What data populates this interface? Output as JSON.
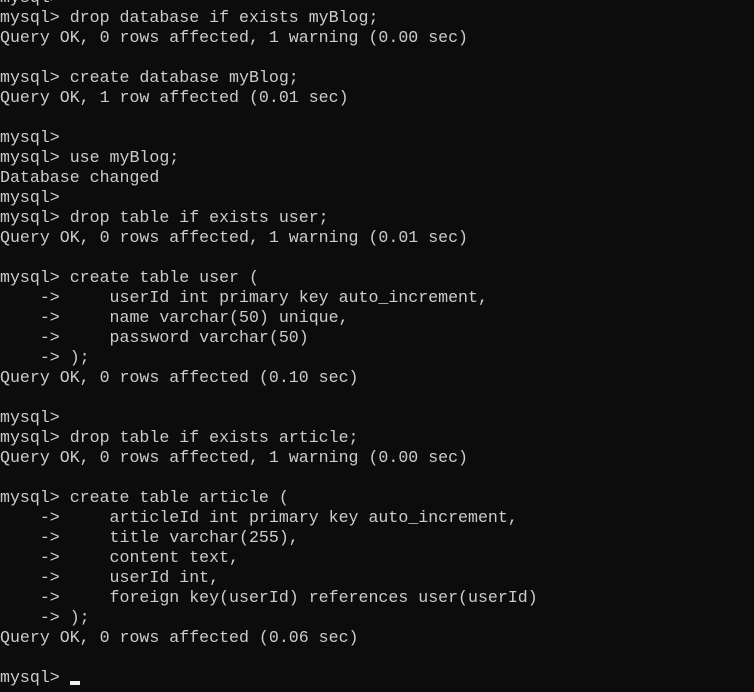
{
  "terminal": {
    "background": "#0c0c0c",
    "foreground": "#cccccc",
    "lines": [
      "mysql>",
      "mysql> drop database if exists myBlog;",
      "Query OK, 0 rows affected, 1 warning (0.00 sec)",
      "",
      "mysql> create database myBlog;",
      "Query OK, 1 row affected (0.01 sec)",
      "",
      "mysql>",
      "mysql> use myBlog;",
      "Database changed",
      "mysql>",
      "mysql> drop table if exists user;",
      "Query OK, 0 rows affected, 1 warning (0.01 sec)",
      "",
      "mysql> create table user (",
      "    ->     userId int primary key auto_increment,",
      "    ->     name varchar(50) unique,",
      "    ->     password varchar(50)",
      "    -> );",
      "Query OK, 0 rows affected (0.10 sec)",
      "",
      "mysql>",
      "mysql> drop table if exists article;",
      "Query OK, 0 rows affected, 1 warning (0.00 sec)",
      "",
      "mysql> create table article (",
      "    ->     articleId int primary key auto_increment,",
      "    ->     title varchar(255),",
      "    ->     content text,",
      "    ->     userId int,",
      "    ->     foreign key(userId) references user(userId)",
      "    -> );",
      "Query OK, 0 rows affected (0.06 sec)",
      ""
    ],
    "prompt": "mysql> "
  }
}
